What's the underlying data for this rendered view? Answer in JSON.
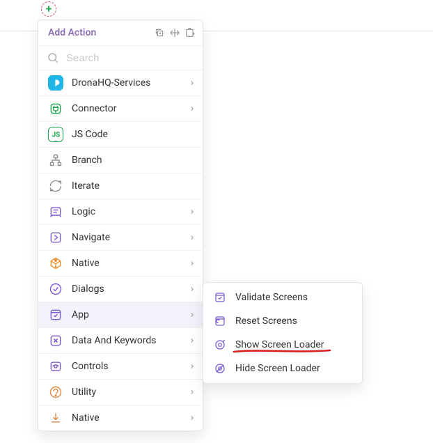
{
  "header": {
    "title": "Add Action"
  },
  "search": {
    "placeholder": "Search",
    "value": ""
  },
  "menu": {
    "items": [
      {
        "label": "DronaHQ-Services"
      },
      {
        "label": "Connector"
      },
      {
        "label": "JS Code"
      },
      {
        "label": "Branch"
      },
      {
        "label": "Iterate"
      },
      {
        "label": "Logic"
      },
      {
        "label": "Navigate"
      },
      {
        "label": "Native"
      },
      {
        "label": "Dialogs"
      },
      {
        "label": "App",
        "selected": true
      },
      {
        "label": "Data And Keywords"
      },
      {
        "label": "Controls"
      },
      {
        "label": "Utility"
      },
      {
        "label": "Native"
      }
    ]
  },
  "submenu": {
    "items": [
      {
        "label": "Validate Screens"
      },
      {
        "label": "Reset Screens"
      },
      {
        "label": "Show Screen Loader",
        "highlighted": true
      },
      {
        "label": "Hide Screen Loader"
      }
    ]
  }
}
